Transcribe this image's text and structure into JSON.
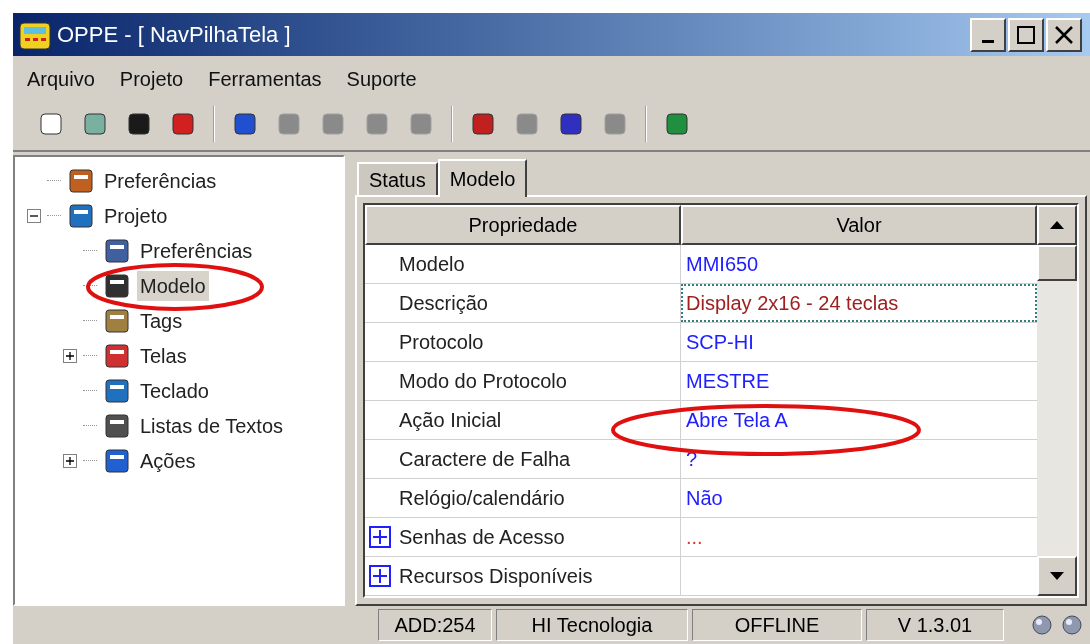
{
  "window": {
    "title": "OPPE - [ NavPilhaTela ]"
  },
  "menu": [
    "Arquivo",
    "Projeto",
    "Ferramentas",
    "Suporte"
  ],
  "toolbar": [
    {
      "kind": "button",
      "disabled": false
    },
    {
      "kind": "button",
      "disabled": false
    },
    {
      "kind": "button",
      "disabled": false
    },
    {
      "kind": "button",
      "disabled": false
    },
    {
      "kind": "separator"
    },
    {
      "kind": "button",
      "disabled": false
    },
    {
      "kind": "button",
      "disabled": true
    },
    {
      "kind": "button",
      "disabled": true
    },
    {
      "kind": "button",
      "disabled": true
    },
    {
      "kind": "button",
      "disabled": true
    },
    {
      "kind": "separator"
    },
    {
      "kind": "button",
      "disabled": false
    },
    {
      "kind": "button",
      "disabled": true
    },
    {
      "kind": "button",
      "disabled": false
    },
    {
      "kind": "button",
      "disabled": true
    },
    {
      "kind": "separator"
    },
    {
      "kind": "button",
      "disabled": false
    }
  ],
  "tree": [
    {
      "label": "Preferências",
      "selected": false
    },
    {
      "label": "Projeto",
      "expanded": true,
      "selected": false,
      "children": [
        {
          "label": "Preferências",
          "selected": false
        },
        {
          "label": "Modelo",
          "selected": true
        },
        {
          "label": "Tags",
          "selected": false
        },
        {
          "label": "Telas",
          "expanded": false,
          "selected": false
        },
        {
          "label": "Teclado",
          "selected": false
        },
        {
          "label": "Listas de Textos",
          "selected": false
        },
        {
          "label": "Ações",
          "expanded": false,
          "selected": false
        }
      ]
    }
  ],
  "tabs": [
    {
      "label": "Status",
      "selected": false
    },
    {
      "label": "Modelo",
      "selected": true
    }
  ],
  "table": {
    "columns": [
      "Propriedade",
      "Valor"
    ],
    "rows": [
      {
        "property": "Modelo",
        "value": "MMI650",
        "color": "#2020ff",
        "expandable": false,
        "focused": false
      },
      {
        "property": "Descrição",
        "value": "Display 2x16 - 24 teclas",
        "color": "#a02020",
        "expandable": false,
        "focused": true
      },
      {
        "property": "Protocolo",
        "value": "SCP-HI",
        "color": "#2020ff",
        "expandable": false,
        "focused": false
      },
      {
        "property": "Modo do Protocolo",
        "value": "MESTRE",
        "color": "#2020ff",
        "expandable": false,
        "focused": false
      },
      {
        "property": "Ação Inicial",
        "value": "Abre Tela A",
        "color": "#2020ff",
        "expandable": false,
        "focused": false
      },
      {
        "property": "Caractere de Falha",
        "value": "?",
        "color": "#2020ff",
        "expandable": false,
        "focused": false
      },
      {
        "property": "Relógio/calendário",
        "value": "Não",
        "color": "#2020ff",
        "expandable": false,
        "focused": false
      },
      {
        "property": "Senhas de Acesso",
        "value": "...",
        "color": "#e03030",
        "expandable": true,
        "focused": false
      },
      {
        "property": "Recursos Disponíveis",
        "expandable": true,
        "focused": false
      }
    ]
  },
  "status_bar": [
    "ADD:254",
    "HI Tecnologia",
    "OFFLINE",
    "V 1.3.01"
  ]
}
